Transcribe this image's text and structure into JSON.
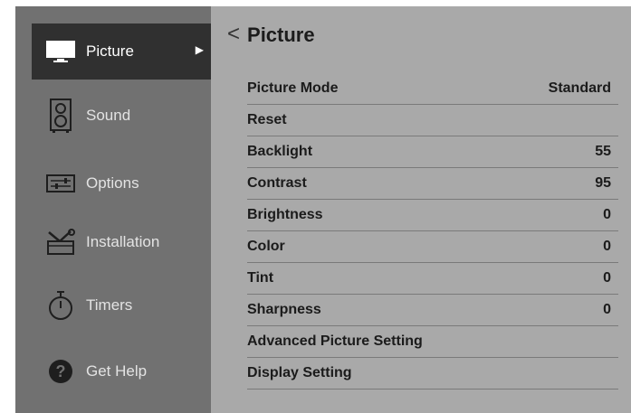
{
  "sidebar": {
    "items": [
      {
        "label": "Picture",
        "icon": "tv-icon",
        "active": true
      },
      {
        "label": "Sound",
        "icon": "speaker-icon"
      },
      {
        "label": "Options",
        "icon": "options-icon"
      },
      {
        "label": "Installation",
        "icon": "tools-icon"
      },
      {
        "label": "Timers",
        "icon": "stopwatch-icon"
      },
      {
        "label": "Get Help",
        "icon": "help-icon"
      }
    ]
  },
  "main": {
    "back": "<",
    "title": "Picture",
    "rows": [
      {
        "label": "Picture  Mode",
        "value": "Standard"
      },
      {
        "label": "Reset",
        "value": ""
      },
      {
        "label": "Backlight",
        "value": "55"
      },
      {
        "label": "Contrast",
        "value": "95"
      },
      {
        "label": "Brightness",
        "value": "0"
      },
      {
        "label": "Color",
        "value": "0"
      },
      {
        "label": "Tint",
        "value": "0"
      },
      {
        "label": "Sharpness",
        "value": "0"
      },
      {
        "label": "Advanced Picture Setting",
        "value": ""
      },
      {
        "label": "Display Setting",
        "value": ""
      }
    ]
  },
  "colors": {
    "sidebar_bg": "#717171",
    "sidebar_active_bg": "#303030",
    "main_bg": "#a9a9a9"
  }
}
